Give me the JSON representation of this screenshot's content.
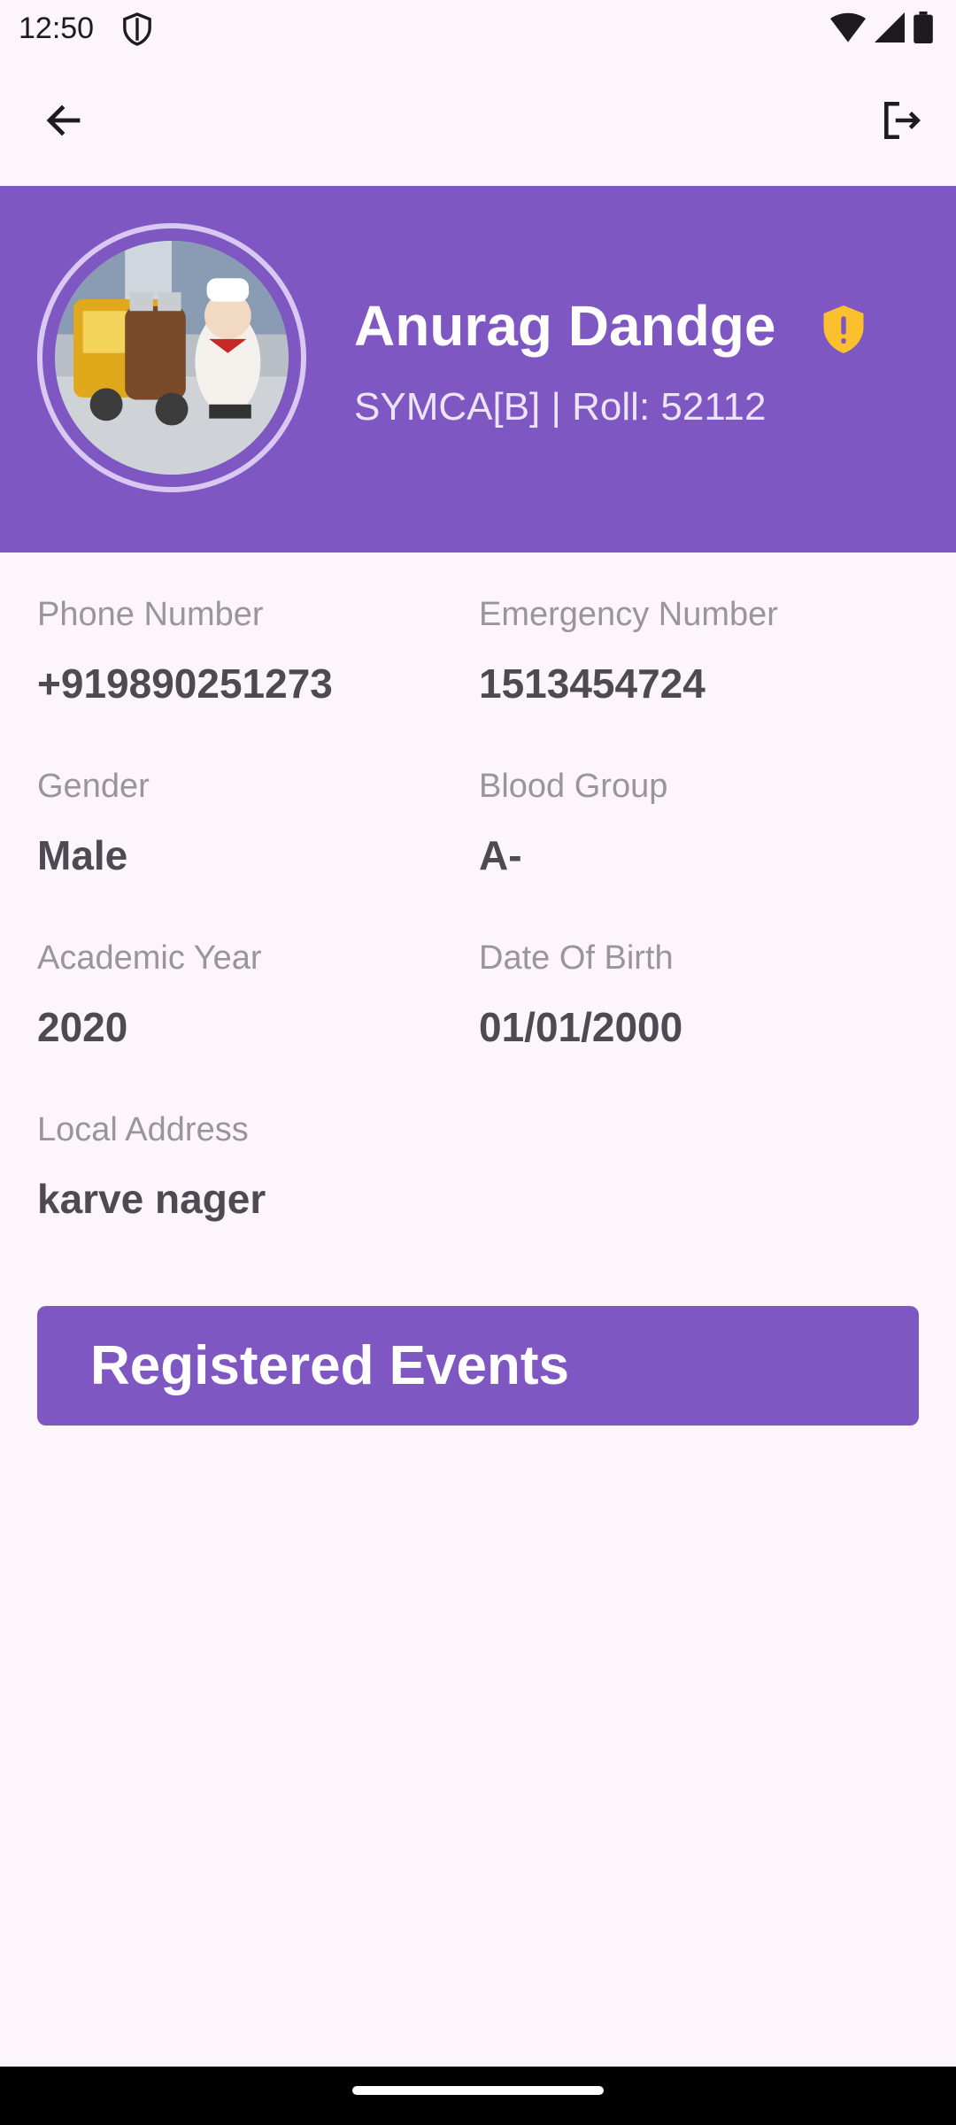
{
  "status_bar": {
    "time": "12:50",
    "icons": [
      "shield-icon",
      "wifi-icon",
      "signal-icon",
      "battery-icon"
    ]
  },
  "top_bar": {
    "back_icon": "arrow-left-icon",
    "logout_icon": "logout-icon"
  },
  "profile": {
    "name": "Anurag Dandge",
    "subtitle": "SYMCA[B] | Roll: 52112",
    "verification_icon": "warning-shield-icon",
    "verification_color": "#FBC02D"
  },
  "fields": [
    {
      "label": "Phone Number",
      "value": "+919890251273"
    },
    {
      "label": "Emergency Number",
      "value": "1513454724"
    },
    {
      "label": "Gender",
      "value": "Male"
    },
    {
      "label": "Blood Group",
      "value": "A-"
    },
    {
      "label": "Academic Year",
      "value": "2020"
    },
    {
      "label": "Date Of Birth",
      "value": "01/01/2000"
    },
    {
      "label": "Local Address",
      "value": "karve nager"
    }
  ],
  "events_button": {
    "label": "Registered Events"
  },
  "colors": {
    "accent": "#7E57C2",
    "background": "#FCF6FC",
    "label": "#9A949D",
    "value": "#4E4A52"
  }
}
